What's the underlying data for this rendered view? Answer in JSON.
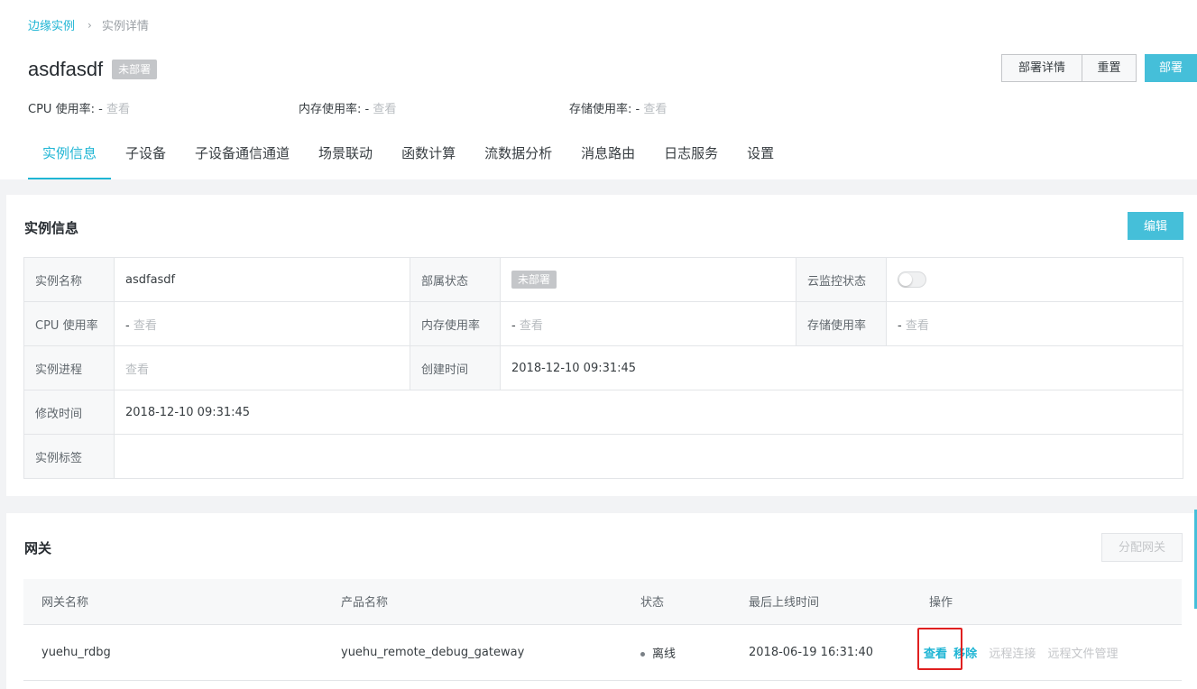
{
  "breadcrumb": {
    "parent": "边缘实例",
    "separator": "›",
    "current": "实例详情"
  },
  "instance": {
    "name": "asdfasdf",
    "status_badge": "未部署"
  },
  "actions": {
    "deploy_details": "部署详情",
    "reset": "重置",
    "deploy": "部署"
  },
  "metrics": [
    {
      "label": "CPU 使用率:",
      "value": "-",
      "link": "查看"
    },
    {
      "label": "内存使用率:",
      "value": "-",
      "link": "查看"
    },
    {
      "label": "存储使用率:",
      "value": "-",
      "link": "查看"
    }
  ],
  "tabs": [
    "实例信息",
    "子设备",
    "子设备通信通道",
    "场景联动",
    "函数计算",
    "流数据分析",
    "消息路由",
    "日志服务",
    "设置"
  ],
  "info_panel": {
    "title": "实例信息",
    "edit_label": "编辑",
    "fields": {
      "name_label": "实例名称",
      "name_value": "asdfasdf",
      "deploy_status_label": "部属状态",
      "deploy_status_value": "未部署",
      "cloud_monitor_label": "云监控状态",
      "cpu_label": "CPU 使用率",
      "cpu_value": "-",
      "cpu_link": "查看",
      "mem_label": "内存使用率",
      "mem_value": "-",
      "mem_link": "查看",
      "storage_label": "存储使用率",
      "storage_value": "-",
      "storage_link": "查看",
      "process_label": "实例进程",
      "process_link": "查看",
      "created_label": "创建时间",
      "created_value": "2018-12-10 09:31:45",
      "modified_label": "修改时间",
      "modified_value": "2018-12-10 09:31:45",
      "tags_label": "实例标签",
      "tags_value": ""
    }
  },
  "gateway_panel": {
    "title": "网关",
    "assign_label": "分配网关",
    "columns": [
      "网关名称",
      "产品名称",
      "状态",
      "最后上线时间",
      "操作"
    ],
    "rows": [
      {
        "name": "yuehu_rdbg",
        "product": "yuehu_remote_debug_gateway",
        "status": "离线",
        "last_online": "2018-06-19 16:31:40",
        "ops": [
          "查看",
          "移除",
          "远程连接",
          "远程文件管理"
        ]
      }
    ]
  },
  "colors": {
    "accent": "#1fb5d4",
    "primary_button": "#45bfd9",
    "badge_gray": "#c4c6c9",
    "highlight": "#e02020"
  }
}
